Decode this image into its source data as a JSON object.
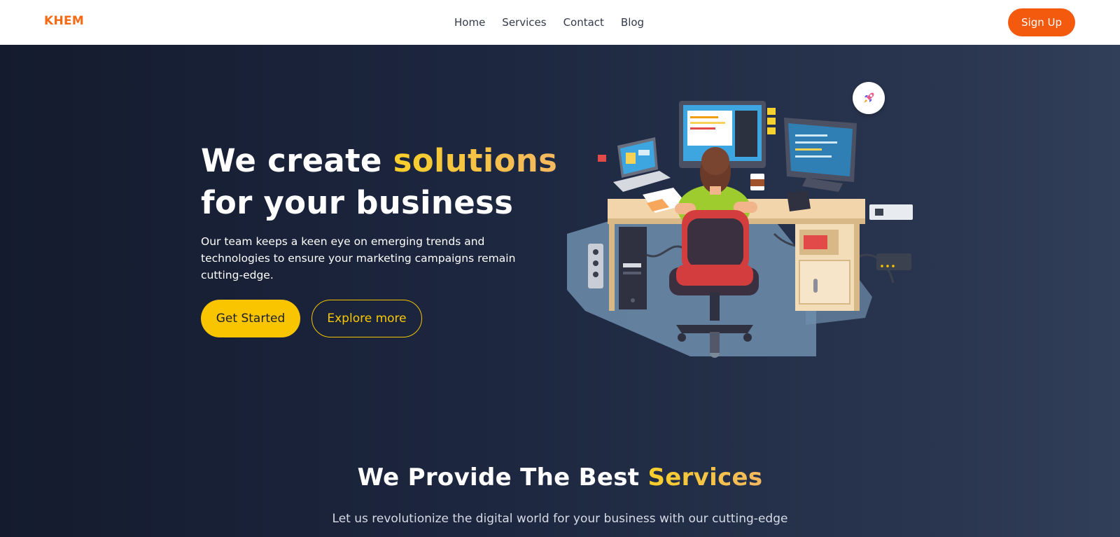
{
  "nav": {
    "logo": "KHEM",
    "links": [
      "Home",
      "Services",
      "Contact",
      "Blog"
    ],
    "signup": "Sign Up"
  },
  "hero": {
    "title_part1": "We create ",
    "title_accent": "solutions",
    "title_part2": "for your business",
    "description": "Our team keeps a keen eye on emerging trends and technologies to ensure your marketing campaigns remain cutting-edge.",
    "primary_button": "Get Started",
    "secondary_button": "Explore more",
    "badge_icon": "rocket-icon",
    "illustration": "developer-at-desk-illustration"
  },
  "services": {
    "title_part1": "We Provide The Best ",
    "title_accent": "Services",
    "subtitle": "Let us revolutionize the digital world for your business with our cutting-edge"
  },
  "colors": {
    "brand": "#f56a14",
    "signup_bg": "#f45a0e",
    "accent_yellow": "#f9c400",
    "hero_bg": "#1d2740"
  }
}
